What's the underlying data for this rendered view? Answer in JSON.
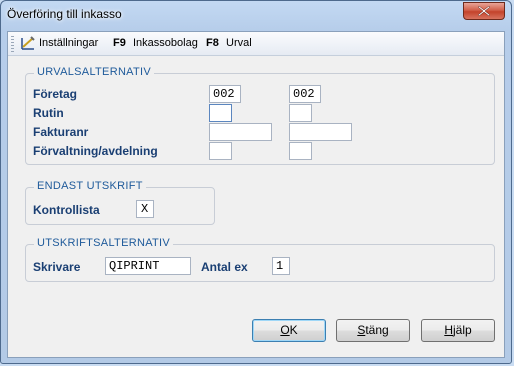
{
  "window": {
    "title": "Överföring till inkasso"
  },
  "toolbar": {
    "settings_label": "Inställningar",
    "f9_key": "F9",
    "f9_label": "Inkassobolag",
    "f8_key": "F8",
    "f8_label": "Urval"
  },
  "urval": {
    "title": "URVALSALTERNATIV",
    "foretag_label": "Företag",
    "foretag_from": "002",
    "foretag_to": "002",
    "rutin_label": "Rutin",
    "rutin_from": "",
    "rutin_to": "",
    "fakturanr_label": "Fakturanr",
    "fakturanr_from": "",
    "fakturanr_to": "",
    "forvaltning_label": "Förvaltning/avdelning",
    "forvaltning_from": "",
    "forvaltning_to": ""
  },
  "endast": {
    "title": "ENDAST UTSKRIFT",
    "kontrollista_label": "Kontrollista",
    "kontrollista_value": "X"
  },
  "utskrift": {
    "title": "UTSKRIFTSALTERNATIV",
    "skrivare_label": "Skrivare",
    "skrivare_value": "QIPRINT",
    "antal_label": "Antal ex",
    "antal_value": "1"
  },
  "buttons": {
    "ok_mn": "O",
    "ok_rest": "K",
    "stang_mn": "S",
    "stang_rest": "täng",
    "hjalp_mn": "H",
    "hjalp_rest": "jälp"
  }
}
